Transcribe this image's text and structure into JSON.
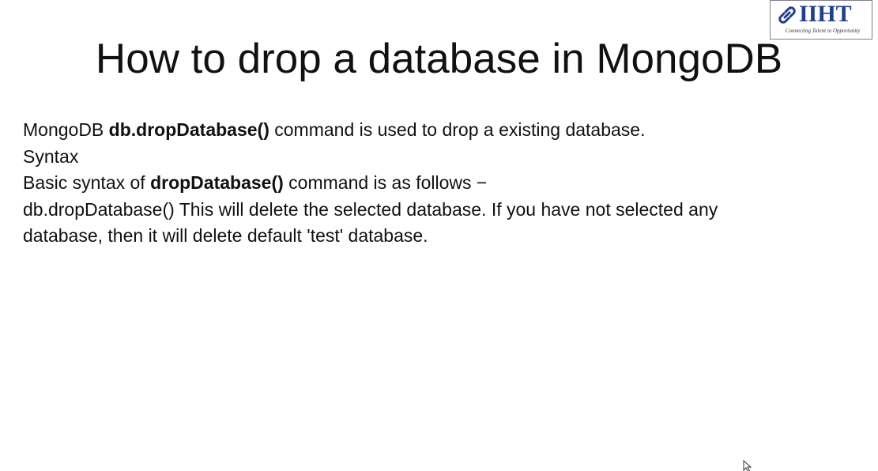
{
  "logo": {
    "brand": "IIHT",
    "tagline": "Connecting Talent to Opportunity",
    "icon": "chain-link-icon",
    "brand_color": "#1e3f8f"
  },
  "slide": {
    "title": "How to drop a database in MongoDB",
    "lines": [
      {
        "pre": "MongoDB ",
        "bold": "db.dropDatabase()",
        "post": " command is used to drop a existing database."
      },
      {
        "text": "Syntax"
      },
      {
        "pre": "Basic syntax of ",
        "bold": "dropDatabase()",
        "post": " command is as follows −"
      },
      {
        "text": "db.dropDatabase() This will delete the selected database. If you have not selected any"
      },
      {
        "text": "database, then it will delete default 'test' database."
      }
    ]
  },
  "cursor": {
    "icon": "mouse-pointer-icon"
  }
}
